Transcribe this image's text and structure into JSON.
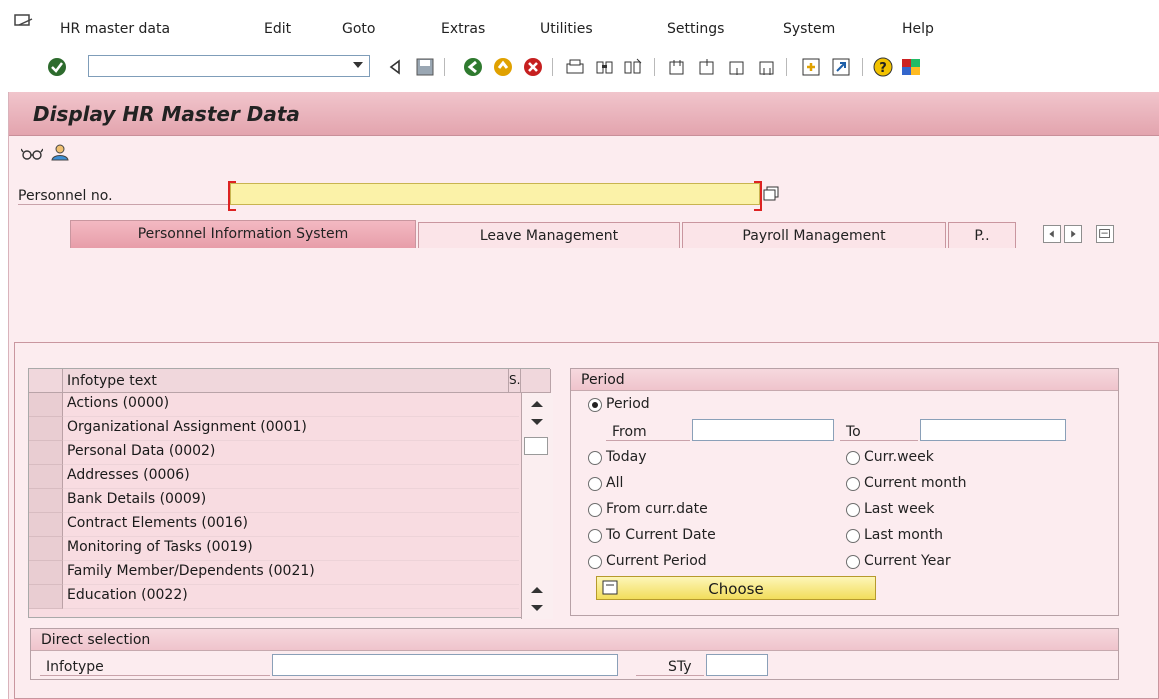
{
  "menu": {
    "items": [
      "HR master data",
      "Edit",
      "Goto",
      "Extras",
      "Utilities",
      "Settings",
      "System",
      "Help"
    ]
  },
  "toolbar": {
    "command_value": ""
  },
  "screen": {
    "title": "Display HR Master Data"
  },
  "personnel": {
    "label": "Personnel no.",
    "value": ""
  },
  "tabs": [
    {
      "label": "Personnel Information System",
      "active": true
    },
    {
      "label": "Leave Management",
      "active": false
    },
    {
      "label": "Payroll Management",
      "active": false
    },
    {
      "label": "P..",
      "active": false
    }
  ],
  "infotype_table": {
    "columns": [
      "Infotype text",
      "S.."
    ],
    "rows": [
      "Actions (0000)",
      "Organizational Assignment (0001)",
      "Personal Data (0002)",
      "Addresses (0006)",
      "Bank Details (0009)",
      "Contract Elements (0016)",
      "Monitoring of Tasks (0019)",
      "Family Member/Dependents (0021)",
      "Education (0022)"
    ]
  },
  "period": {
    "group_title": "Period",
    "period_option": "Period",
    "from_label": "From",
    "from_value": "",
    "to_label": "To",
    "to_value": "",
    "options_left": [
      "Today",
      "All",
      "From curr.date",
      "To Current Date",
      "Current Period"
    ],
    "options_right": [
      "Curr.week",
      "Current month",
      "Last week",
      "Last month",
      "Current Year"
    ],
    "selected": "Period",
    "choose_label": "Choose"
  },
  "direct_selection": {
    "group_title": "Direct selection",
    "infotype_label": "Infotype",
    "infotype_value": "",
    "sty_label": "STy",
    "sty_value": ""
  },
  "colors": {
    "title_bar": "#e8a9b3",
    "panel_bg": "#fcecef",
    "required_field": "#fbf2a8",
    "button_yellow": "#f2dd5c"
  }
}
